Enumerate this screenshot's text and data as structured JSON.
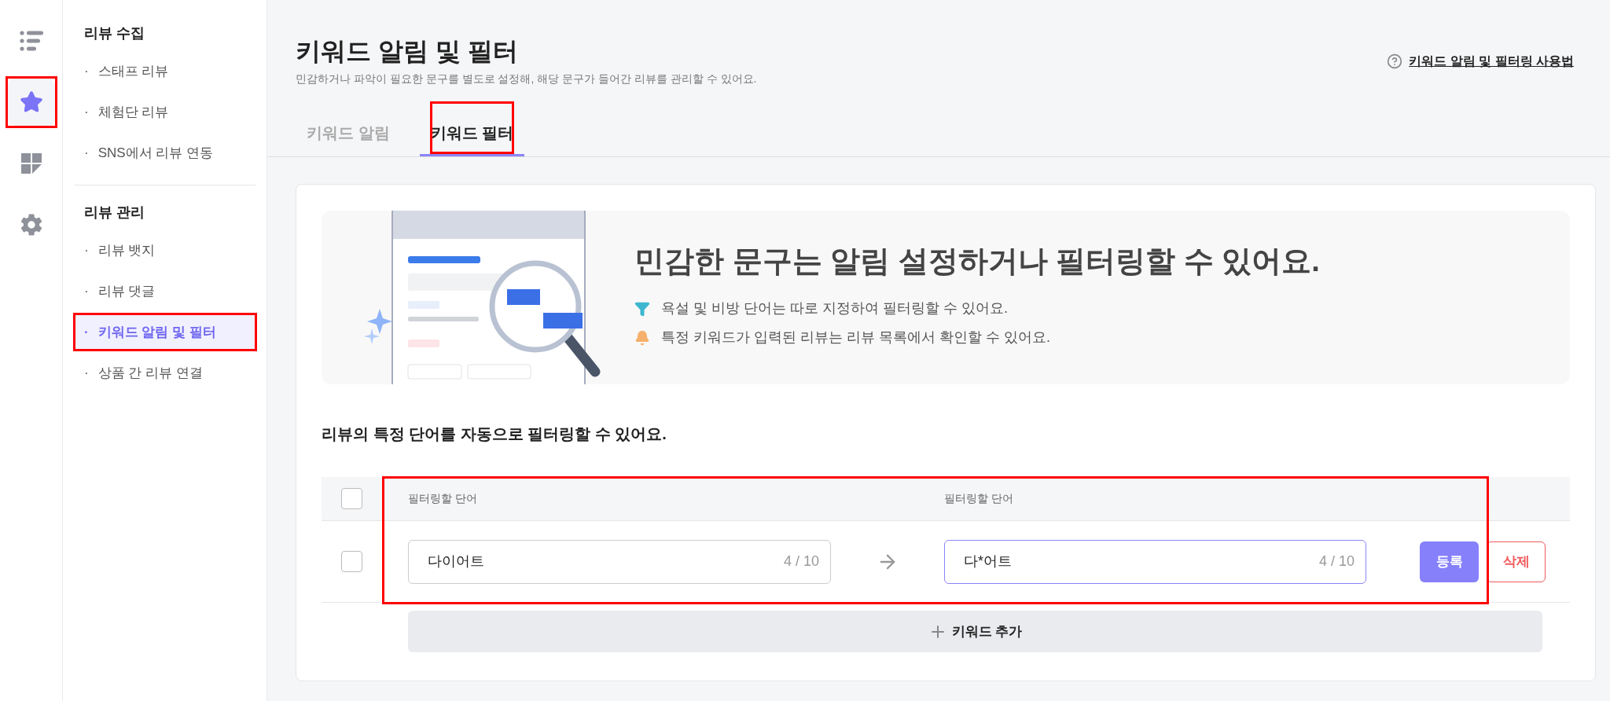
{
  "rail": [
    {
      "selected": false,
      "highlighted": false
    },
    {
      "selected": true,
      "highlighted": true
    },
    {
      "selected": false,
      "highlighted": false
    },
    {
      "selected": false,
      "highlighted": false
    }
  ],
  "sidebar": {
    "sections": [
      {
        "title": "리뷰 수집",
        "items": [
          {
            "bullet": "·",
            "label": "스태프 리뷰",
            "selected": false,
            "highlighted": false
          },
          {
            "bullet": "·",
            "label": "체험단 리뷰",
            "selected": false,
            "highlighted": false
          },
          {
            "bullet": "·",
            "label": "SNS에서 리뷰 연동",
            "selected": false,
            "highlighted": false
          }
        ]
      },
      {
        "title": "리뷰 관리",
        "items": [
          {
            "bullet": "·",
            "label": "리뷰 뱃지",
            "selected": false,
            "highlighted": false
          },
          {
            "bullet": "·",
            "label": "리뷰 댓글",
            "selected": false,
            "highlighted": false
          },
          {
            "bullet": "·",
            "label": "키워드 알림 및 필터",
            "selected": true,
            "highlighted": true
          },
          {
            "bullet": "·",
            "label": "상품 간 리뷰 연결",
            "selected": false,
            "highlighted": false
          }
        ]
      }
    ]
  },
  "header": {
    "title": "키워드 알림 및 필터",
    "subtitle": "민감하거나 파악이 필요한 문구를 별도로 설정해, 해당 문구가 들어간 리뷰를 관리할 수 있어요.",
    "help_link": "키워드 알림 및 필터링 사용법"
  },
  "tabs": [
    {
      "label": "키워드 알림",
      "selected": false,
      "highlighted": false
    },
    {
      "label": "키워드 필터",
      "selected": true,
      "highlighted": true
    }
  ],
  "banner": {
    "headline": "민감한 문구는 알림 설정하거나 필터링할 수 있어요.",
    "points": [
      {
        "text": "욕설 및 비방 단어는 따로 지정하여 필터링할 수 있어요."
      },
      {
        "text": "특정 키워드가 입력된 리뷰는 리뷰 목록에서 확인할 수 있어요."
      }
    ]
  },
  "section_heading": "리뷰의 특정 단어를 자동으로 필터링할 수 있어요.",
  "table": {
    "highlighted": true,
    "header_checked": false,
    "columns": [
      "필터링할 단어",
      "필터링할 단어"
    ],
    "rows": [
      {
        "checked": false,
        "source": {
          "value": "다이어트",
          "counter": "4 / 10",
          "focused": false
        },
        "replacement": {
          "value": "다*어트",
          "counter": "4 / 10",
          "focused": true
        },
        "actions": [
          {
            "kind": "primary",
            "label": "등록"
          },
          {
            "kind": "danger",
            "label": "삭제"
          }
        ]
      }
    ]
  },
  "add_button": {
    "label": "키워드 추가"
  }
}
